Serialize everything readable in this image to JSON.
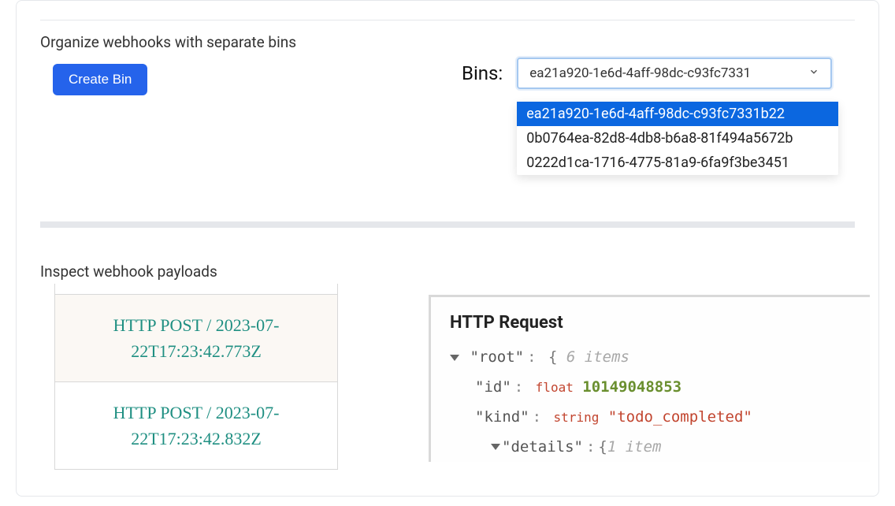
{
  "section1": {
    "title": "Organize webhooks with separate bins",
    "create_btn": "Create Bin",
    "bins_label": "Bins:",
    "selected_display": "ea21a920-1e6d-4aff-98dc-c93fc7331",
    "options": [
      "ea21a920-1e6d-4aff-98dc-c93fc7331b22",
      "0b0764ea-82d8-4db8-b6a8-81f494a5672b",
      "0222d1ca-1716-4775-81a9-6fa9f3be3451"
    ]
  },
  "section2": {
    "title": "Inspect webhook payloads",
    "rows": [
      "HTTP POST / 2023-07-22T17:23:42.773Z",
      "HTTP POST / 2023-07-22T17:23:42.832Z"
    ]
  },
  "request": {
    "title": "HTTP Request",
    "root_key": "\"root\"",
    "root_meta": "6 items",
    "id_key": "\"id\"",
    "id_type": "float",
    "id_val": "10149048853",
    "kind_key": "\"kind\"",
    "kind_type": "string",
    "kind_val": "\"todo_completed\"",
    "details_key": "\"details\"",
    "details_meta": "1 item"
  }
}
